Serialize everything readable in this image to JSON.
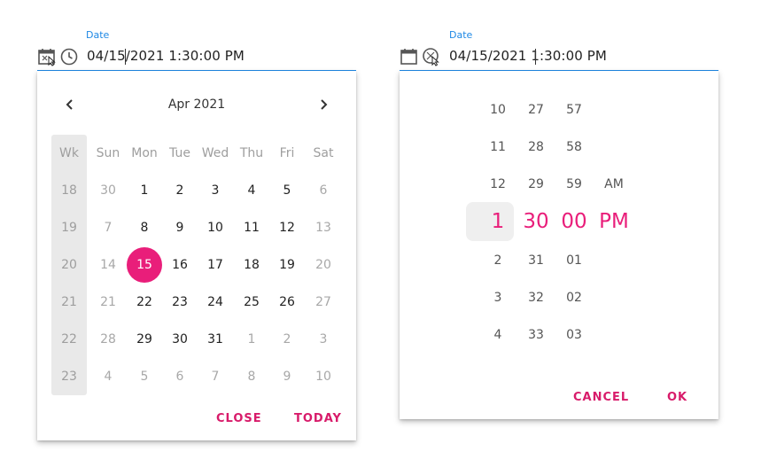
{
  "left_field": {
    "label": "Date",
    "value_a": "04/15",
    "value_b": "/2021 1:30:00 PM"
  },
  "right_field": {
    "label": "Date",
    "value_a": "04/15/2021 1",
    "value_b": ":30:00 PM"
  },
  "calendar": {
    "title": "Apr 2021",
    "headers": [
      "Wk",
      "Sun",
      "Mon",
      "Tue",
      "Wed",
      "Thu",
      "Fri",
      "Sat"
    ],
    "weeks": [
      {
        "wk": "18",
        "days": [
          "30",
          "1",
          "2",
          "3",
          "4",
          "5",
          "6"
        ],
        "cur": [
          false,
          true,
          true,
          true,
          true,
          true,
          false
        ]
      },
      {
        "wk": "19",
        "days": [
          "7",
          "8",
          "9",
          "10",
          "11",
          "12",
          "13"
        ],
        "cur": [
          false,
          true,
          true,
          true,
          true,
          true,
          false
        ]
      },
      {
        "wk": "20",
        "days": [
          "14",
          "15",
          "16",
          "17",
          "18",
          "19",
          "20"
        ],
        "cur": [
          false,
          true,
          true,
          true,
          true,
          true,
          false
        ]
      },
      {
        "wk": "21",
        "days": [
          "21",
          "22",
          "23",
          "24",
          "25",
          "26",
          "27"
        ],
        "cur": [
          false,
          true,
          true,
          true,
          true,
          true,
          false
        ]
      },
      {
        "wk": "22",
        "days": [
          "28",
          "29",
          "30",
          "31",
          "1",
          "2",
          "3"
        ],
        "cur": [
          false,
          true,
          true,
          true,
          false,
          false,
          false
        ]
      },
      {
        "wk": "23",
        "days": [
          "4",
          "5",
          "6",
          "7",
          "8",
          "9",
          "10"
        ],
        "cur": [
          false,
          false,
          false,
          false,
          false,
          false,
          false
        ]
      }
    ],
    "selected": "15",
    "close_label": "CLOSE",
    "today_label": "TODAY"
  },
  "time": {
    "hours_above": [
      "10",
      "11",
      "12"
    ],
    "hour": "1",
    "hours_below": [
      "2",
      "3",
      "4"
    ],
    "minutes_above": [
      "27",
      "28",
      "29"
    ],
    "minute": "30",
    "minutes_below": [
      "31",
      "32",
      "33"
    ],
    "seconds_above": [
      "57",
      "58",
      "59"
    ],
    "second": "00",
    "seconds_below": [
      "01",
      "02",
      "03"
    ],
    "ampm_above": "AM",
    "ampm": "PM",
    "cancel_label": "CANCEL",
    "ok_label": "OK"
  },
  "colors": {
    "accent": "#e91e7a",
    "focus": "#1e88e5",
    "week_bg": "#e9e9e9"
  }
}
